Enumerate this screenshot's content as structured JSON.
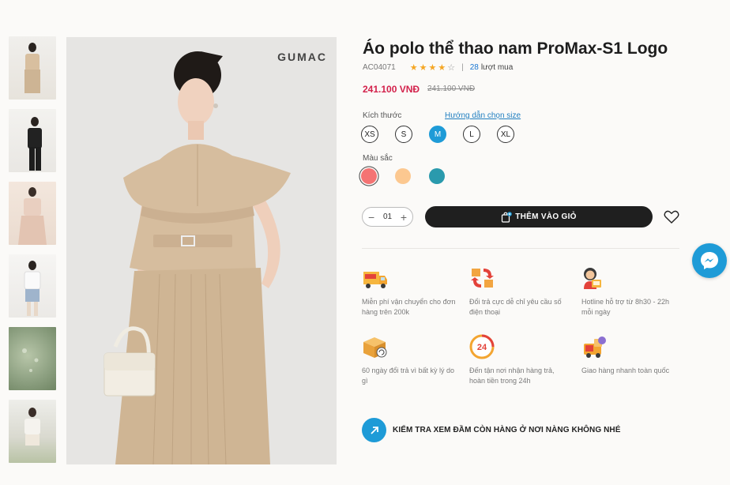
{
  "gallery": {
    "thumbnails": [
      "thumb-1",
      "thumb-2",
      "thumb-3",
      "thumb-4",
      "thumb-5",
      "thumb-6"
    ],
    "selected_index": 0,
    "brand_watermark": "GUMAC"
  },
  "product": {
    "title": "Áo polo thể thao nam ProMax-S1 Logo",
    "sku": "AC04071",
    "rating": 4,
    "rating_max": 5,
    "buy_count": "28",
    "buy_label": "lượt mua",
    "price": "241.100 VNĐ",
    "price_old": "241.100 VNĐ"
  },
  "size": {
    "label": "Kích thước",
    "guide_link": "Hướng dẫn chọn size",
    "options": [
      "XS",
      "S",
      "M",
      "L",
      "XL"
    ],
    "selected": "M"
  },
  "color": {
    "label": "Màu sắc",
    "options": [
      "#f47373",
      "#fcc890",
      "#2a9aad"
    ],
    "selected_index": 0
  },
  "cart": {
    "quantity": "01",
    "minus": "−",
    "plus": "+",
    "add_label": "THÊM VÀO GIỎ"
  },
  "features": [
    {
      "icon": "free-shipping-truck-icon",
      "text": "Miễn phí vận chuyển cho đơn hàng trên 200k"
    },
    {
      "icon": "exchange-boxes-icon",
      "text": "Đổi trả cực dễ chỉ yêu cầu số điện thoại"
    },
    {
      "icon": "hotline-support-icon",
      "text": "Hotline hỗ trợ từ 8h30 - 22h mỗi ngày"
    },
    {
      "icon": "return-box-icon",
      "text": "60 ngày đổi trả vì bất kỳ lý do gì"
    },
    {
      "icon": "24h-clock-icon",
      "text": "Đến tận nơi nhận hàng trả, hoàn tiền trong 24h"
    },
    {
      "icon": "fast-delivery-icon",
      "text": "Giao hàng nhanh toàn quốc"
    }
  ],
  "check_store": {
    "label": "KIỂM TRA XEM ĐẦM CÒN HÀNG Ở NƠI NÀNG KHÔNG NHÉ"
  },
  "colors": {
    "accent": "#1e9bd7",
    "price": "#d3214b",
    "button": "#1f1f1f",
    "star": "#f5a623"
  }
}
